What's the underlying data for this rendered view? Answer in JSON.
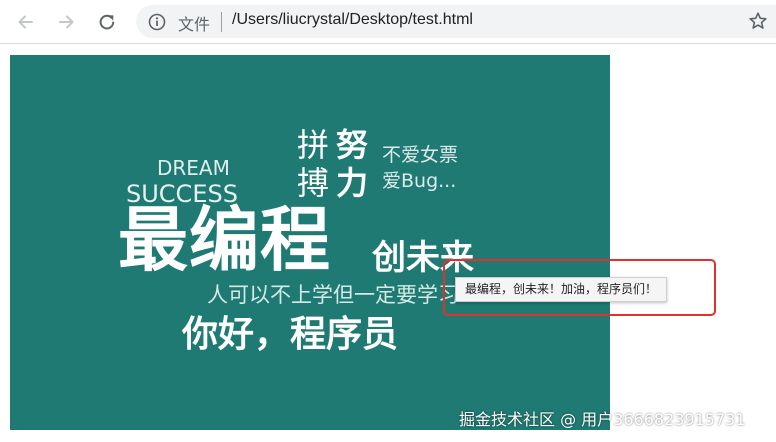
{
  "browser": {
    "address_bar": {
      "scheme_label": "文件",
      "url": "/Users/liucrystal/Desktop/test.html"
    },
    "icons": {
      "back": "arrow-left",
      "forward": "arrow-right",
      "reload": "reload",
      "info": "info-circle",
      "bookmark": "star"
    }
  },
  "page": {
    "banner_color": "#1e7a72",
    "words": {
      "dream": "DREAM",
      "success": "SUCCESS",
      "main": "最编程",
      "pin": "拼",
      "nu": "努",
      "bo": "搏",
      "li": "力",
      "note1": "不爱女票",
      "note2": "爱Bug...",
      "chuang": "创未来",
      "line": "人可以不上学但一定要学习",
      "hello": "你好，程序员"
    },
    "tooltip": "最编程，创未来！加油，程序员们！",
    "highlight_color": "#e0312c"
  },
  "watermark": "掘金技术社区 @ 用户3666823915731"
}
